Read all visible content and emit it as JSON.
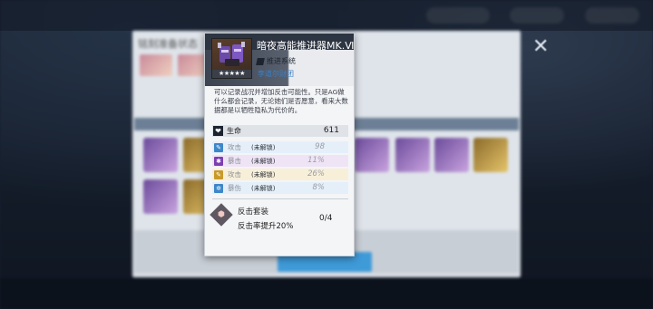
{
  "item": {
    "name": "暗夜高能推进器MK.Ⅵ",
    "stars": "★★★★★",
    "category": "推进系统",
    "faction": "李道尔财团",
    "description": "可以记录战况并增加反击可能性。只是AG做什么都会记录，无论她们是否愿意，看来大数据都是以牺牲隐私为代价的。"
  },
  "base_stat": {
    "label": "生命",
    "value": "611",
    "icon": "heart-icon"
  },
  "sub_stats": [
    {
      "label": "攻击",
      "status": "(未解锁)",
      "value": "98",
      "icon": "sword-icon",
      "color": "#3d86c9",
      "bg": "#e4effa"
    },
    {
      "label": "暴击",
      "status": "(未解锁)",
      "value": "11%",
      "icon": "crit-icon",
      "color": "#7b3fb2",
      "bg": "#efe4f6"
    },
    {
      "label": "攻击",
      "status": "(未解锁)",
      "value": "26%",
      "icon": "sword-icon",
      "color": "#c99a2a",
      "bg": "#f8efd9"
    },
    {
      "label": "暴伤",
      "status": "(未解锁)",
      "value": "8%",
      "icon": "critdmg-icon",
      "color": "#3d86c9",
      "bg": "#e4effa"
    }
  ],
  "set_bonus": {
    "name": "反击套装",
    "effect": "反击率提升20%",
    "progress": "0/4",
    "icon": "counter-set-icon"
  },
  "background": {
    "panel_title": "铭刻准备状态",
    "close_icon": "close-icon"
  },
  "colors": {
    "accent_blue": "#3d7fc2",
    "header_dark": "#2e3542"
  }
}
